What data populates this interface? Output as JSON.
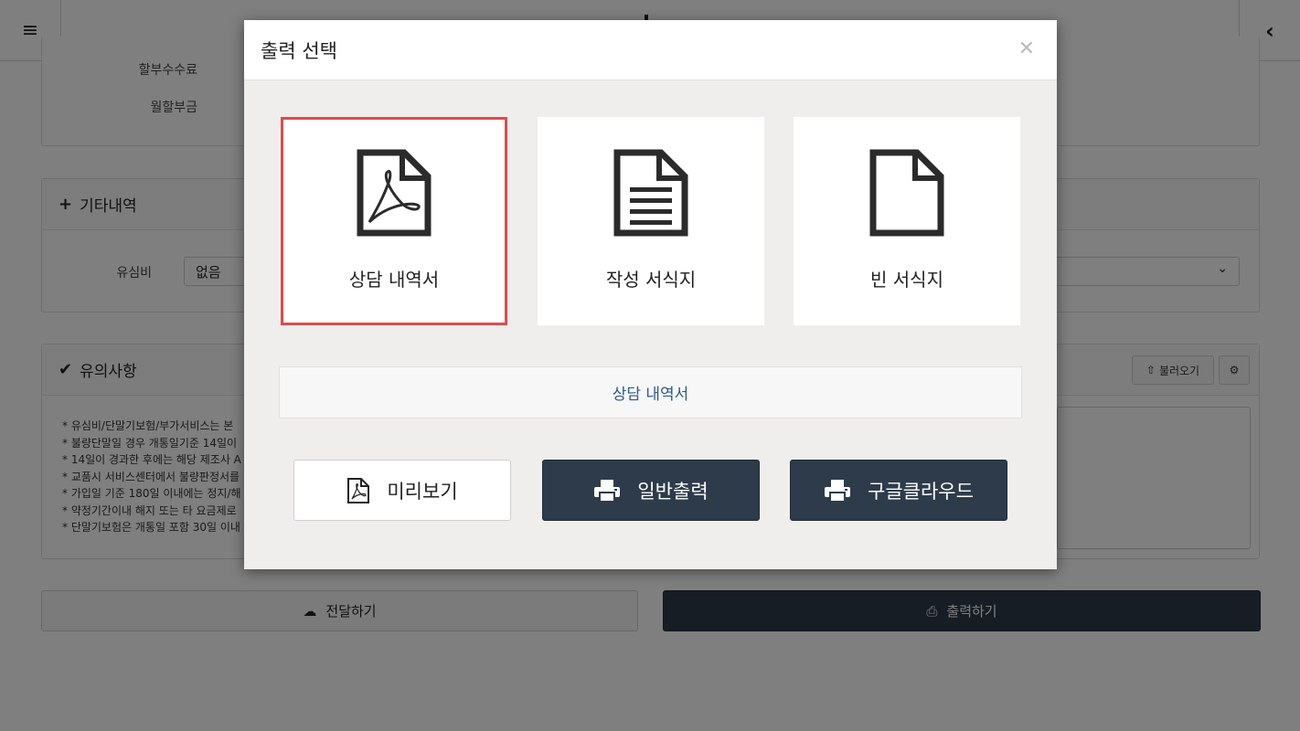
{
  "background": {
    "topbar": {
      "menu_icon": "hamburger-icon",
      "back_icon": "chevron-left-icon"
    },
    "installment_panel": {
      "rows": [
        {
          "label": "할부수수료"
        },
        {
          "label": "월할부금"
        }
      ]
    },
    "other_panel": {
      "title": "기타내역",
      "icon": "plus-icon",
      "usim_label": "유심비",
      "usim_value": "없음"
    },
    "notice_panel": {
      "title": "유의사항",
      "icon": "check-icon",
      "load_label": "불러오기",
      "settings_icon": "gear-icon",
      "lines": [
        "* 유심비/단말기보험/부가서비스는 본",
        "* 불량단말일 경우 개통일기준 14일이",
        "* 14일이 경과한 후에는 해당 제조사 A",
        "* 교품시 서비스센터에서 불량판정서를",
        "* 가입일 기준 180일 이내에는 정지/해",
        "* 약정기간이내 해지 또는 타 요금제로",
        "* 단말기보험은 개통일 포함 30일 이내"
      ]
    },
    "bottom": {
      "send_label": "전달하기",
      "send_icon": "cloud-download-icon",
      "print_label": "출력하기",
      "print_icon": "printer-icon"
    }
  },
  "modal": {
    "title": "출력 선택",
    "close_icon": "close-icon",
    "cards": [
      {
        "label": "상담 내역서",
        "icon": "pdf-file-icon",
        "selected": true
      },
      {
        "label": "작성 서식지",
        "icon": "text-file-icon",
        "selected": false
      },
      {
        "label": "빈 서식지",
        "icon": "blank-file-icon",
        "selected": false
      }
    ],
    "selected_name": "상담 내역서",
    "actions": {
      "preview_label": "미리보기",
      "preview_icon": "pdf-file-icon",
      "print_label": "일반출력",
      "print_icon": "printer-icon",
      "cloud_label": "구글클라우드",
      "cloud_icon": "printer-icon"
    },
    "colors": {
      "selected_border": "#e04b4b",
      "dark_button": "#2e3b4a",
      "selection_text": "#2a5b8c"
    }
  }
}
